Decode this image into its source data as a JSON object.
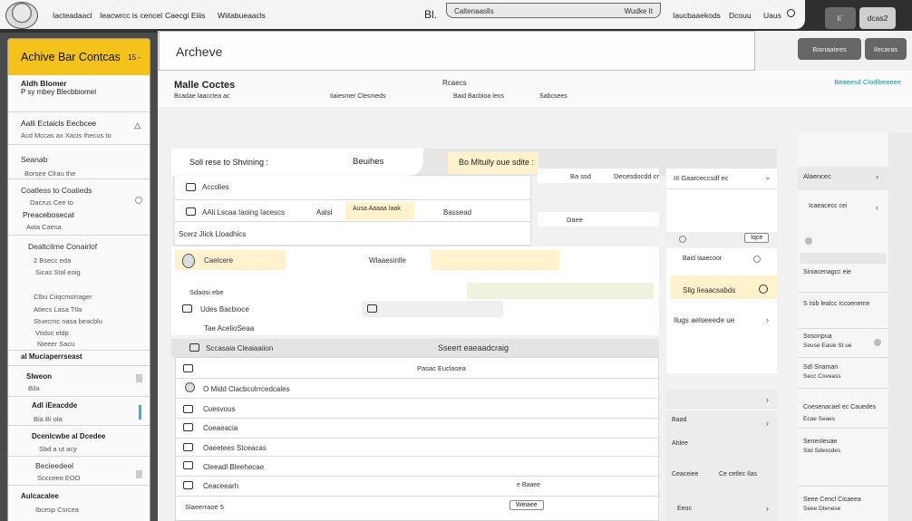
{
  "topbar": {
    "nav": [
      "Iacteadaacl",
      "Ieacwrcc  is  cencel",
      "Caecgi Eiiis",
      "Wiitabueaacls"
    ],
    "brand": "Bl.",
    "url_left": "Caltenaaslls",
    "url_right": "Wudke It",
    "right_links": [
      "Iaucbaaekods",
      "Dcouu",
      "Uaus"
    ],
    "btn_dark": "Ii´",
    "btn_light": "dcas2"
  },
  "sidebar": {
    "title": "Achive Bar Contcas",
    "close": "15 -",
    "items": [
      {
        "label": "Aldh Blomer",
        "sub": "P sy mbey Blecbbiomel"
      },
      {
        "label": "Aalli Ectaicls Eecbcee",
        "sub": "Acd Mccas ax Xacis Ihecus to"
      },
      {
        "label": "Seanab",
        "sub": "Borsee Clrau the"
      },
      {
        "label": "Coatless to Coatieds",
        "sub": "Dacrus Cee to"
      },
      {
        "label": "Preacebosecat",
        "sub": "Aoia Caesa"
      },
      {
        "label": "Dealtcilme Conairlof",
        "sub": ""
      },
      {
        "label": "",
        "sub": "2 Bsecc eda"
      },
      {
        "label": "",
        "sub": "Sicas Stal eoig"
      },
      {
        "label": "",
        "sub": "Clbu Ciiqcmorrager"
      },
      {
        "label": "",
        "sub": "Atiecs Lasa Ttla"
      },
      {
        "label": "",
        "sub": "Stuecmc nasa beacblu"
      },
      {
        "label": "",
        "sub": "Vtidsc eldp"
      },
      {
        "label": "",
        "sub": "Nieeer Sacu"
      },
      {
        "label": "al Muciaperrseast",
        "sub": ""
      },
      {
        "label": "Slweon",
        "sub": "Bila"
      },
      {
        "label": "Adl iEeacdde",
        "sub": "Bia Bi  ola"
      },
      {
        "label": "Dcenlcwbe al Dcedee",
        "sub": "Sbd a ut acy"
      },
      {
        "label": "Becieedeel",
        "sub": "Sccceeo EOO"
      },
      {
        "label": "Aulcacalee",
        "sub": "Ibcesp Csrcea"
      }
    ]
  },
  "main": {
    "archive_title": "Archeve",
    "page_title": "Malle Coctes",
    "page_sub": "Bcadae Iaacctea ac",
    "col_heads": [
      "Rcaecs",
      "Iiaiesmer Clesmeds",
      "Baid Bacbioa lens",
      "Sabcsees"
    ],
    "right_link": "Beaeesd Clodlbeeeee",
    "toolbar_title": "Soll rese to Shvining :",
    "toolbar_mid": "Beuihes",
    "toolbar_right": "Bo Mltuily oue sdite :",
    "rows_a": [
      "Accolies",
      "AAli Lscaa Iaoing Iacescs",
      "Scerz Jlick Lloadhics"
    ],
    "row_a_mid": "Aalsl",
    "row_a_tag": "Ausa Aaaaa Iaak",
    "row_a_right": "Bassead",
    "mid_cells": [
      "Ba ssd",
      "Decesdocdd cr",
      "Daee"
    ],
    "contact": "Caelcere",
    "contact_tag": "Wlaaesinlle",
    "list": [
      "Sdaosi   ebe",
      "Udes Bacbioce",
      "Tae AcelioSeaa",
      "Sccasaia Cleaiaaiion"
    ],
    "list_mid": "Bcadae Seaorecolcas",
    "list_center": "Sseert eaeaadcraig",
    "rows_b": [
      "",
      "O Midd Clacbcolrrcedcales",
      "Cuesvous",
      "Coeaeacia",
      "Oaeetees Stceacas",
      "Cleeadl Bleehecae",
      "Ceaceearh"
    ],
    "rows_b_center": "Pasac Euclasea",
    "bottom_left": "Slaeerraoe  5",
    "bottom_tag": "Weiaee",
    "bottom_mid": "e Baaee",
    "col3": [
      "III Gaarceccsdf ec",
      "Baid Iaaecoor",
      "Sllg  Iieaacsabds",
      "Ilugs aelseeede ue",
      "Baad",
      "Ahlee",
      "Ceaceiee",
      "Eeoc"
    ],
    "col3_tag": "Iqce",
    "col3_right": "Ce cetlec Ilas"
  },
  "right_panel": {
    "buttons": [
      "Bianaatees",
      "Ilecaras"
    ],
    "items": [
      {
        "label": "Alaencec",
        "sub": ""
      },
      {
        "label": "Icaeacecc cei",
        "sub": ""
      },
      {
        "label": "Siniacenagcc eie",
        "sub": ""
      },
      {
        "label": "S Isib lealcc Iccoeneme",
        "sub": ""
      },
      {
        "label": "Sosonpua",
        "sub": "Seuse Easie St ue"
      },
      {
        "label": "Sdl Snaman",
        "sub": "Secc Coveass"
      },
      {
        "label": "Coesenacael ec Cauedes",
        "sub": "Ecae Seaes"
      },
      {
        "label": "Seneoleuae",
        "sub": "Siol Sdescdes"
      },
      {
        "label": "Seee Cencl Cicaeea",
        "sub": "Seee Dtenese"
      }
    ]
  }
}
